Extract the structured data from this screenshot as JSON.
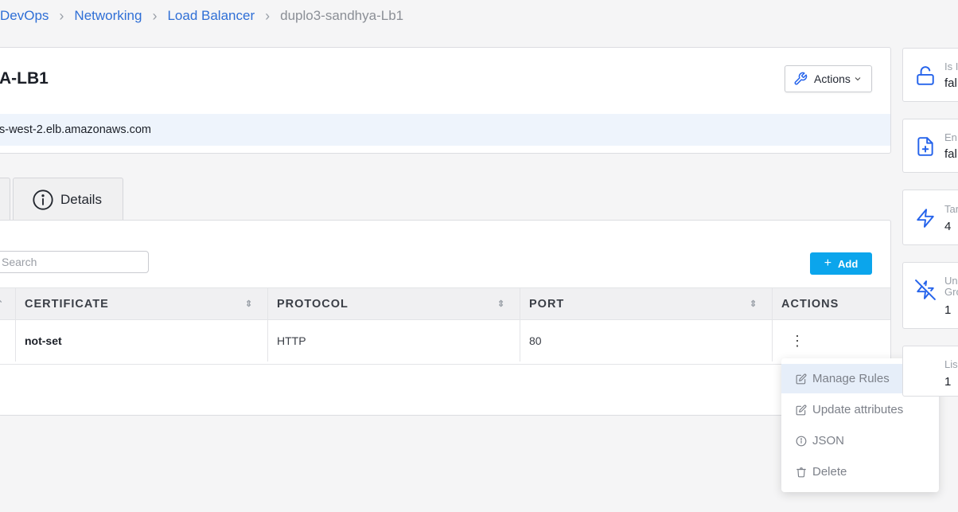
{
  "breadcrumb": {
    "items": [
      "DevOps",
      "Networking",
      "Load Balancer"
    ],
    "current": "duplo3-sandhya-Lb1"
  },
  "header": {
    "title": "A-LB1",
    "actions_label": "Actions",
    "dns_name": "s-west-2.elb.amazonaws.com"
  },
  "tabs": {
    "details_label": "Details"
  },
  "table": {
    "search_placeholder": "Search",
    "add_label": "Add",
    "columns": [
      "CERTIFICATE",
      "PROTOCOL",
      "PORT",
      "ACTIONS"
    ],
    "rows": [
      {
        "certificate": "not-set",
        "protocol": "HTTP",
        "port": "80"
      }
    ]
  },
  "row_menu": {
    "items": [
      "Manage Rules",
      "Update attributes",
      "JSON",
      "Delete"
    ]
  },
  "stats": [
    {
      "label": "Is I",
      "value": "fal",
      "icon": "unlock-icon"
    },
    {
      "label": "En",
      "value": "fal",
      "icon": "file-plus-icon"
    },
    {
      "label": "Tar",
      "value": "4",
      "icon": "zap-icon"
    },
    {
      "label": "Un\nGro",
      "value": "1",
      "icon": "zap-off-icon"
    },
    {
      "label": "Lis",
      "value": "1",
      "icon": ""
    }
  ],
  "colors": {
    "link": "#2f6fd6",
    "primary": "#0ba5ec",
    "icon_blue": "#2563eb",
    "menu_active": "#e6eef9"
  }
}
